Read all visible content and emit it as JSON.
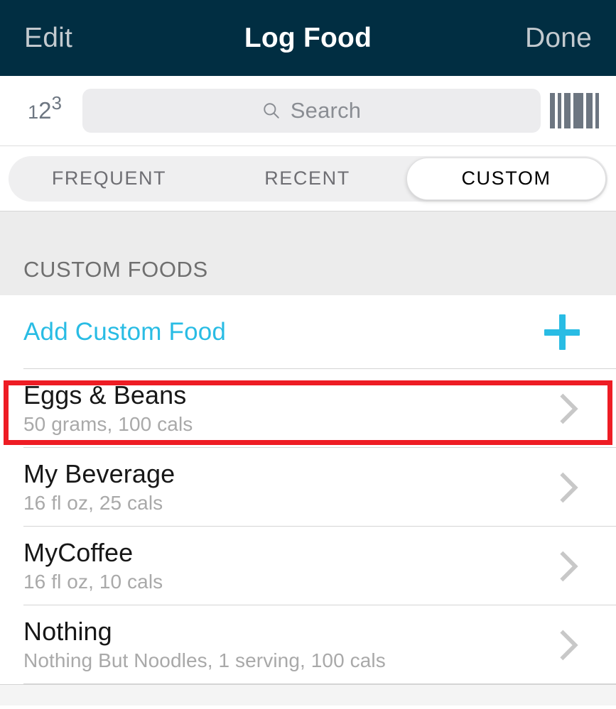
{
  "navbar": {
    "edit_label": "Edit",
    "title": "Log Food",
    "done_label": "Done"
  },
  "search": {
    "quick_add_icon": "123-icon",
    "quick_add_digits": [
      "1",
      "2",
      "3"
    ],
    "search_icon": "search-icon",
    "placeholder": "Search",
    "value": "",
    "barcode_icon": "barcode-scanner-icon"
  },
  "tabs": {
    "items": [
      {
        "label": "FREQUENT",
        "selected": false
      },
      {
        "label": "RECENT",
        "selected": false
      },
      {
        "label": "CUSTOM",
        "selected": true
      }
    ]
  },
  "section": {
    "header": "CUSTOM FOODS"
  },
  "add_custom": {
    "label": "Add Custom Food",
    "icon": "plus-icon"
  },
  "foods": [
    {
      "name": "Eggs & Beans",
      "details": "50 grams, 100 cals",
      "highlighted": true
    },
    {
      "name": "My Beverage",
      "details": "16 fl oz, 25 cals",
      "highlighted": false
    },
    {
      "name": "MyCoffee",
      "details": "16 fl oz, 10 cals",
      "highlighted": false
    },
    {
      "name": "Nothing",
      "details": "Nothing But Noodles, 1 serving, 100 cals",
      "highlighted": false
    }
  ],
  "colors": {
    "navbar_background": "#012e42",
    "navbar_title": "#ffffff",
    "navbar_button": "#c3cacf",
    "accent_cyan": "#29bce4",
    "annotation_red": "#ee1c24",
    "section_background": "#ececec",
    "subtitle_gray": "#a9a9a9",
    "chevron_gray": "#c8c8c8"
  }
}
